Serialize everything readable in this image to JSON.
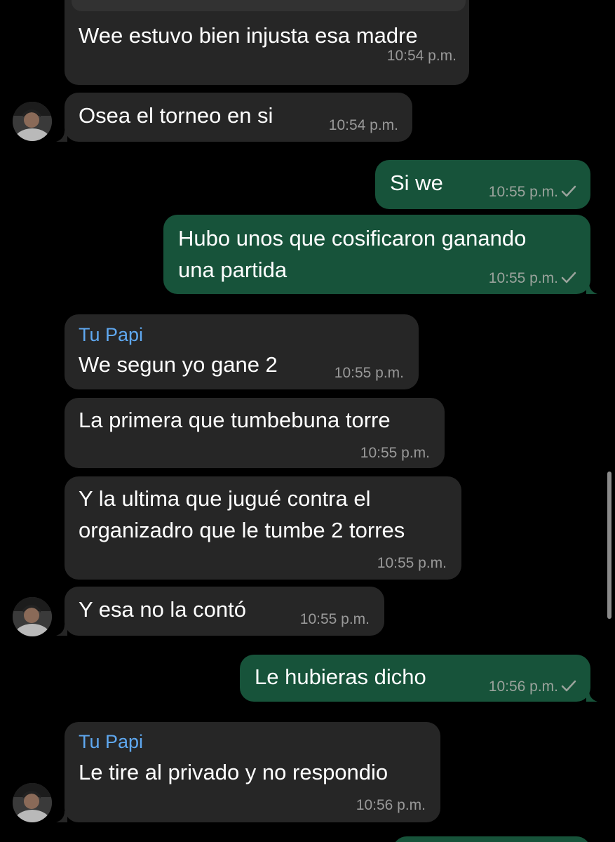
{
  "messages": [
    {
      "text": "Wee estuvo bien injusta esa madre",
      "time": "10:54 p.m."
    },
    {
      "text": "Osea el torneo en si",
      "time": "10:54 p.m."
    },
    {
      "text": "Si we",
      "time": "10:55 p.m."
    },
    {
      "text_line1": "Hubo unos que cosificaron ganando",
      "text_line2": "una partida",
      "time": "10:55 p.m."
    },
    {
      "sender": "Tu Papi",
      "text": "We segun yo gane 2",
      "time": "10:55 p.m."
    },
    {
      "text": "La primera que tumbebuna torre",
      "time": "10:55 p.m."
    },
    {
      "text_line1": "Y la ultima que jugué contra el",
      "text_line2": "organizadro que le tumbe 2 torres",
      "time": "10:55 p.m."
    },
    {
      "text": "Y esa no la contó",
      "time": "10:55 p.m."
    },
    {
      "text": "Le hubieras dicho",
      "time": "10:56 p.m."
    },
    {
      "sender": "Tu Papi",
      "text": "Le tire al privado y no respondio",
      "time": "10:56 p.m."
    }
  ],
  "colors": {
    "incoming_bubble": "#262626",
    "outgoing_bubble": "#17533a",
    "sender_name": "#5fa8f0",
    "background": "#000000"
  },
  "icons": {
    "sent_check": "checkmark-icon",
    "avatar": "user-avatar"
  }
}
